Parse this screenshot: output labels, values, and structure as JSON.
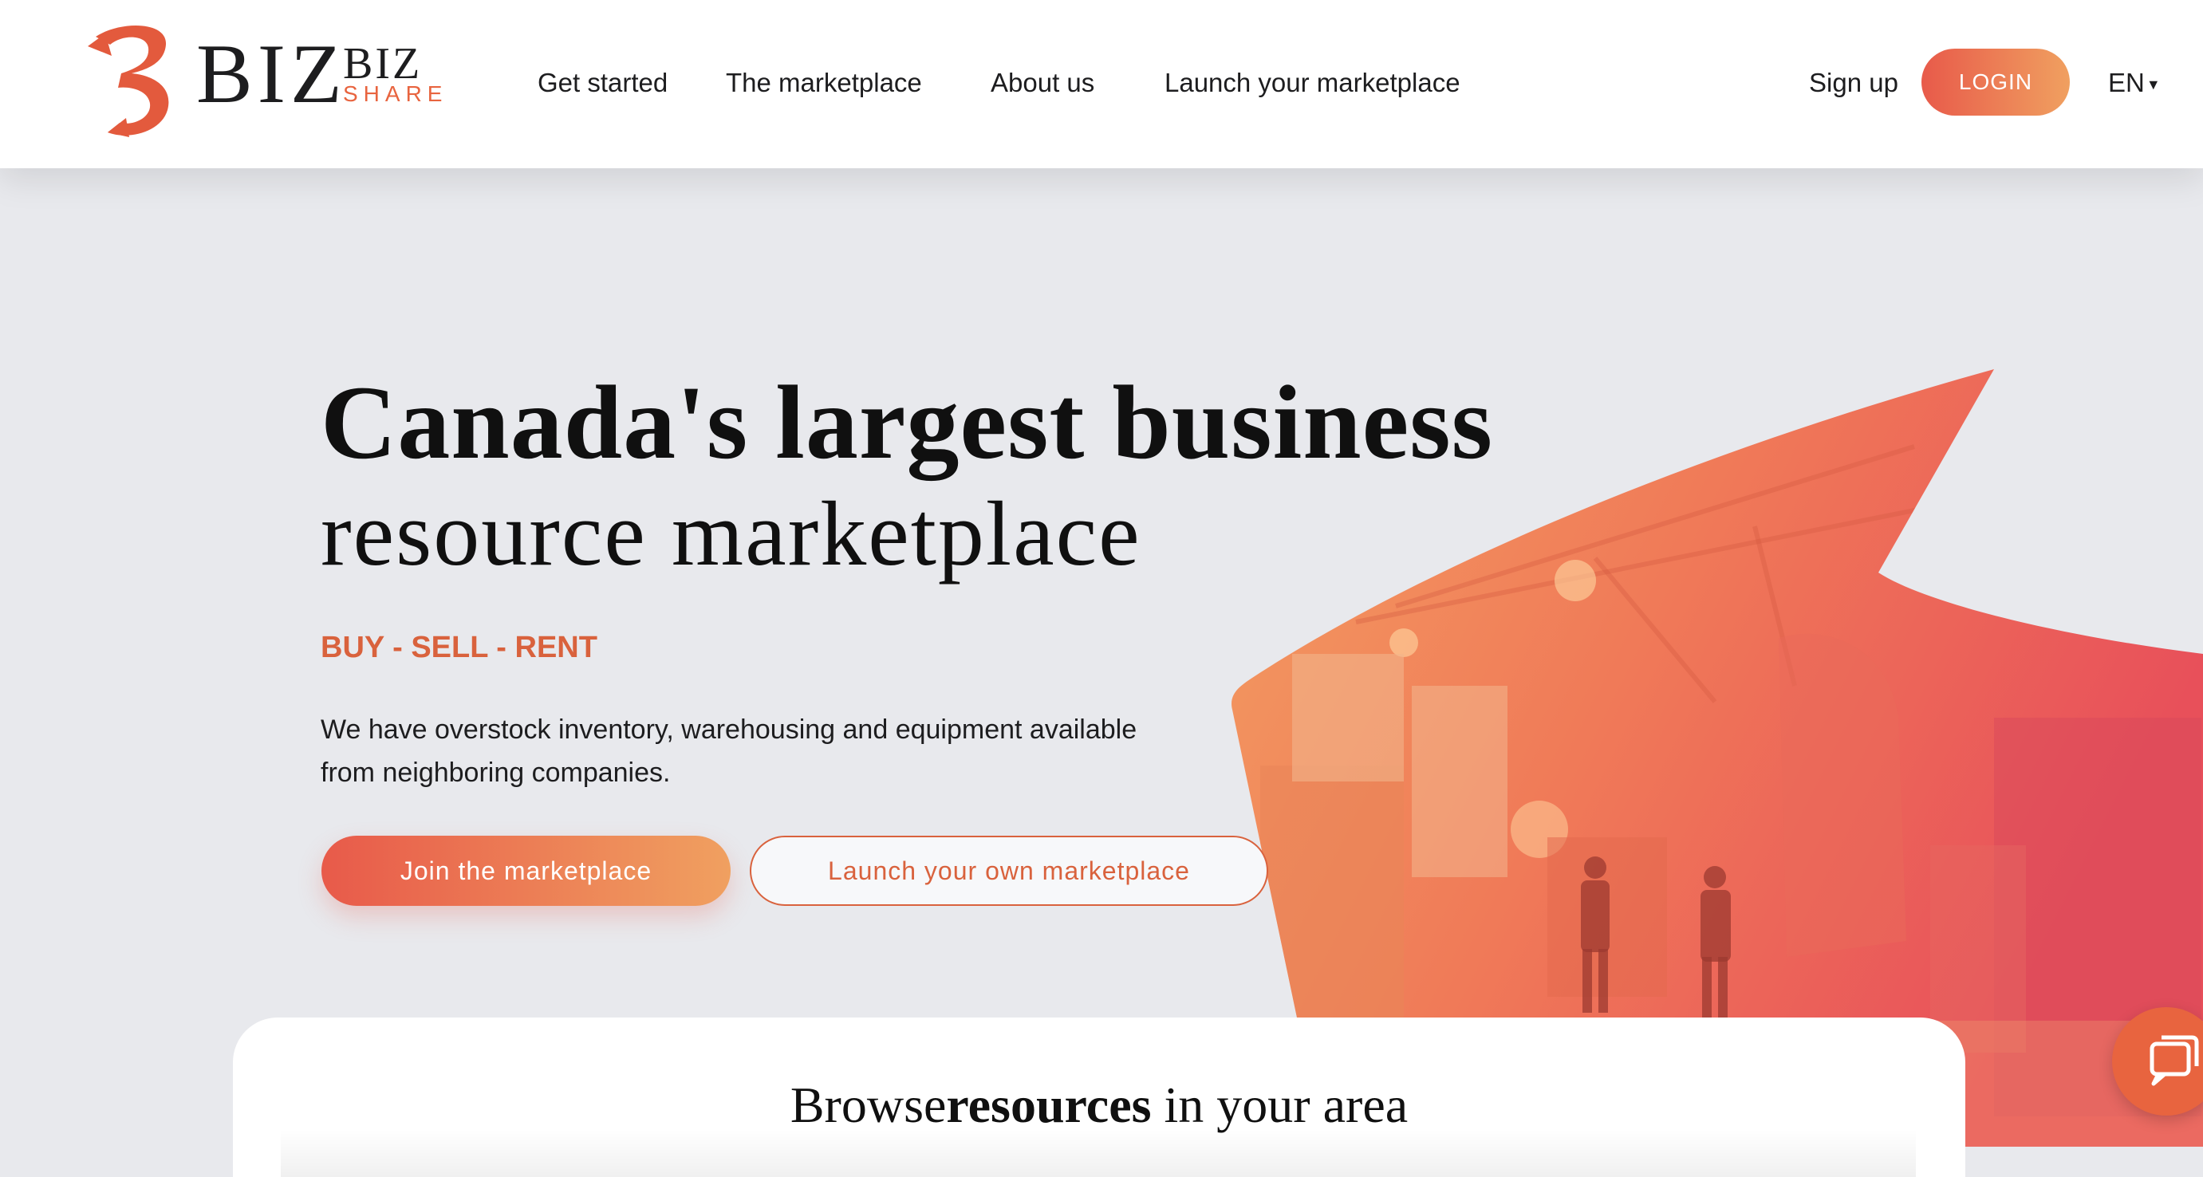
{
  "header": {
    "logo": {
      "word1": "BIZ",
      "word2": "BIZ",
      "word3": "SHARE"
    },
    "nav": [
      {
        "label": "Get started"
      },
      {
        "label": "The marketplace"
      },
      {
        "label": "About us"
      },
      {
        "label": "Launch your marketplace"
      }
    ],
    "signup_label": "Sign up",
    "login_label": "LOGIN",
    "language": "EN"
  },
  "hero": {
    "headline_line1": "Canada's largest business",
    "headline_line2": "resource marketplace",
    "tagline": "BUY - SELL - RENT",
    "description": "We have overstock inventory, warehousing and equipment available from neighboring companies.",
    "join_button": "Join the marketplace",
    "launch_button": "Launch your own marketplace"
  },
  "browse": {
    "title_part1": "Browse",
    "title_bold": "resources",
    "title_part2": " in your area"
  },
  "colors": {
    "accent": "#e8643f",
    "gradient_start": "#e85a4a",
    "gradient_end": "#f0a060",
    "background": "#e8e9ed"
  },
  "icons": {
    "logo": "bizbizshare-logo-icon",
    "chat": "chat-bubbles-icon",
    "language_caret": "caret-down-icon"
  }
}
